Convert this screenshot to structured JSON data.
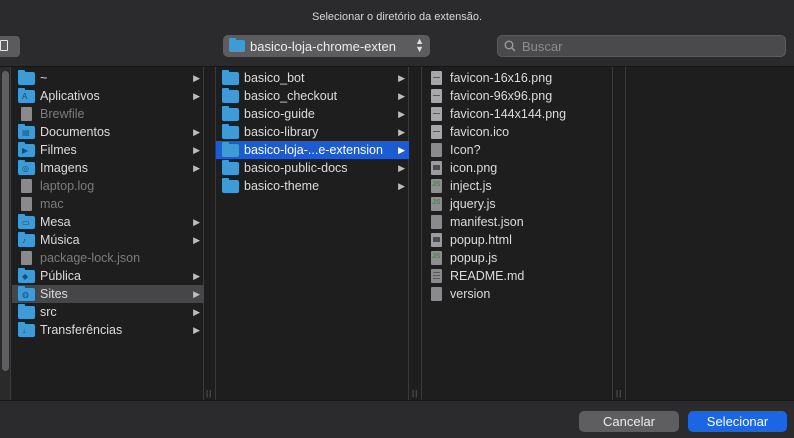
{
  "dialog": {
    "title": "Selecionar o diretório da extensão."
  },
  "toolbar": {
    "path_label": "basico-loja-chrome-exten",
    "search_placeholder": "Buscar"
  },
  "column1": [
    {
      "label": "~",
      "kind": "folder",
      "chevron": true,
      "dim": false
    },
    {
      "label": "Aplicativos",
      "kind": "folder-app",
      "chevron": true,
      "dim": false
    },
    {
      "label": "Brewfile",
      "kind": "file",
      "chevron": false,
      "dim": true
    },
    {
      "label": "Documentos",
      "kind": "folder-doc",
      "chevron": true,
      "dim": false
    },
    {
      "label": "Filmes",
      "kind": "folder-film",
      "chevron": true,
      "dim": false
    },
    {
      "label": "Imagens",
      "kind": "folder-pic",
      "chevron": true,
      "dim": false
    },
    {
      "label": "laptop.log",
      "kind": "file",
      "chevron": false,
      "dim": true
    },
    {
      "label": "mac",
      "kind": "file",
      "chevron": false,
      "dim": true
    },
    {
      "label": "Mesa",
      "kind": "folder-desk",
      "chevron": true,
      "dim": false
    },
    {
      "label": "Música",
      "kind": "folder-music",
      "chevron": true,
      "dim": false
    },
    {
      "label": "package-lock.json",
      "kind": "file",
      "chevron": false,
      "dim": true
    },
    {
      "label": "Pública",
      "kind": "folder-public",
      "chevron": true,
      "dim": false
    },
    {
      "label": "Sites",
      "kind": "folder-sites",
      "chevron": true,
      "dim": false,
      "selected": "gray"
    },
    {
      "label": "src",
      "kind": "folder",
      "chevron": true,
      "dim": false
    },
    {
      "label": "Transferências",
      "kind": "folder-dl",
      "chevron": true,
      "dim": false
    }
  ],
  "column2": [
    {
      "label": "basico_bot",
      "chevron": true
    },
    {
      "label": "basico_checkout",
      "chevron": true
    },
    {
      "label": "basico-guide",
      "chevron": true
    },
    {
      "label": "basico-library",
      "chevron": true
    },
    {
      "label": "basico-loja-...e-extension",
      "chevron": true,
      "selected": "blue"
    },
    {
      "label": "basico-public-docs",
      "chevron": true
    },
    {
      "label": "basico-theme",
      "chevron": true
    }
  ],
  "column3": [
    {
      "label": "favicon-16x16.png",
      "kind": "png"
    },
    {
      "label": "favicon-96x96.png",
      "kind": "png"
    },
    {
      "label": "favicon-144x144.png",
      "kind": "png"
    },
    {
      "label": "favicon.ico",
      "kind": "png"
    },
    {
      "label": "Icon?",
      "kind": "doc"
    },
    {
      "label": "icon.png",
      "kind": "img"
    },
    {
      "label": "inject.js",
      "kind": "js"
    },
    {
      "label": "jquery.js",
      "kind": "js"
    },
    {
      "label": "manifest.json",
      "kind": "doc"
    },
    {
      "label": "popup.html",
      "kind": "img"
    },
    {
      "label": "popup.js",
      "kind": "js"
    },
    {
      "label": "README.md",
      "kind": "txt"
    },
    {
      "label": "version",
      "kind": "doc"
    }
  ],
  "footer": {
    "cancel_label": "Cancelar",
    "select_label": "Selecionar"
  },
  "colors": {
    "accent": "#1a66e4",
    "selection": "#1d5bd1",
    "folder": "#3f9bd6"
  }
}
